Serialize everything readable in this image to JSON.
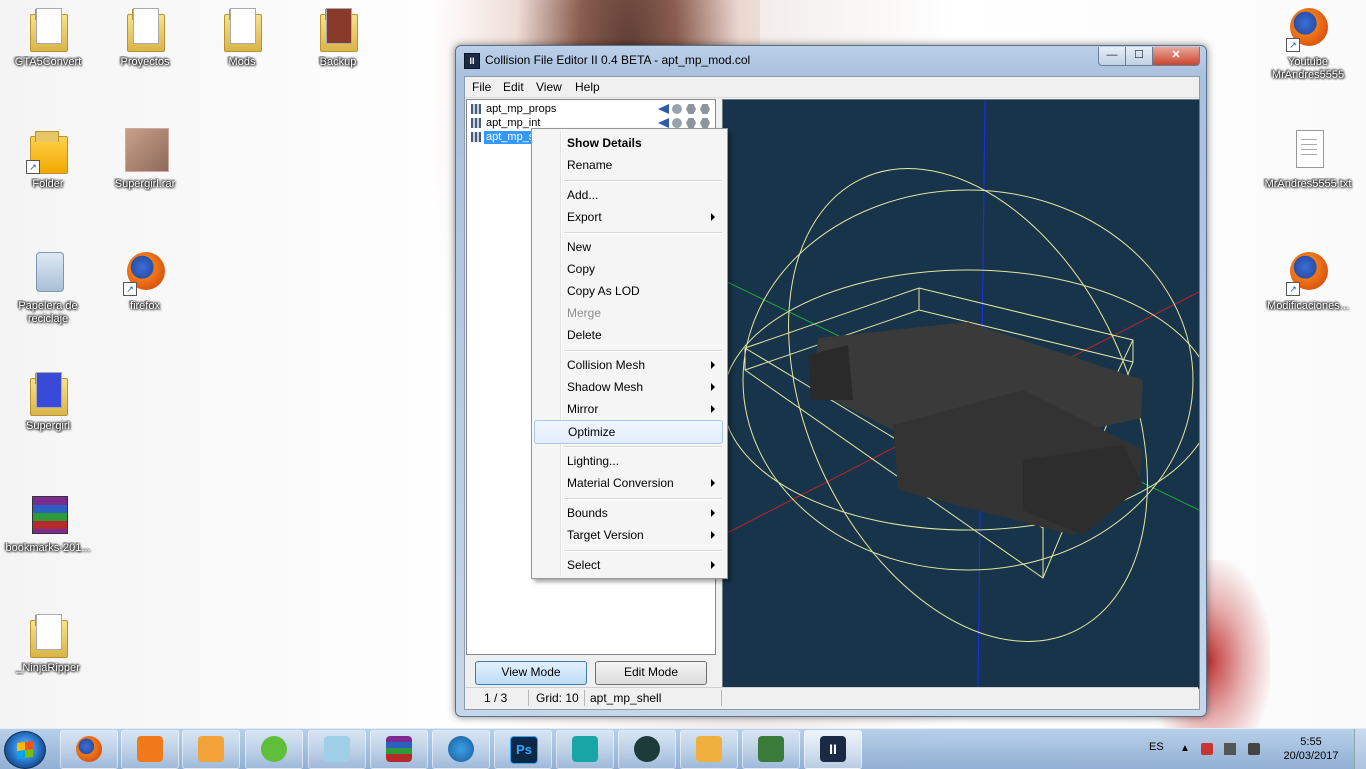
{
  "desktop": {
    "icons": [
      {
        "label": "GTA5Convert",
        "icon": "folder-icon"
      },
      {
        "label": "Proyectos",
        "icon": "folder-icon"
      },
      {
        "label": "Mods",
        "icon": "folder-icon"
      },
      {
        "label": "Backup",
        "icon": "folder-icon"
      },
      {
        "label": "Folder",
        "icon": "folder-shortcut-icon"
      },
      {
        "label": "Supergirl.rar",
        "icon": "archive-icon"
      },
      {
        "label": "Papelera de reciclaje",
        "icon": "recycle-bin-icon"
      },
      {
        "label": "firefox",
        "icon": "firefox-icon"
      },
      {
        "label": "Supergirl",
        "icon": "folder-icon"
      },
      {
        "label": "bookmarks-201...",
        "icon": "winrar-icon"
      },
      {
        "label": "_NinjaRipper",
        "icon": "folder-icon"
      },
      {
        "label": "Youtube MrAndres5555",
        "icon": "firefox-icon"
      },
      {
        "label": "MrAndres5555.txt",
        "icon": "text-file-icon"
      },
      {
        "label": "Modificaciones...",
        "icon": "firefox-icon"
      }
    ]
  },
  "window": {
    "title": "Collision File Editor II 0.4 BETA - apt_mp_mod.col",
    "controls": {
      "minimize": "—",
      "maximize": "☐",
      "close": "✕"
    }
  },
  "menubar": [
    "File",
    "Edit",
    "View",
    "Help"
  ],
  "tree": {
    "items": [
      {
        "label": "apt_mp_props",
        "selected": false
      },
      {
        "label": "apt_mp_int",
        "selected": false
      },
      {
        "label": "apt_mp_s",
        "selected": true
      }
    ]
  },
  "context_menu": {
    "items": [
      {
        "label": "Show Details",
        "bold": true
      },
      {
        "label": "Rename"
      },
      {
        "label": "Add..."
      },
      {
        "label": "Export",
        "submenu": true
      },
      {
        "label": "New"
      },
      {
        "label": "Copy"
      },
      {
        "label": "Copy As LOD"
      },
      {
        "label": "Merge",
        "disabled": true
      },
      {
        "label": "Delete"
      },
      {
        "label": "Collision Mesh",
        "submenu": true
      },
      {
        "label": "Shadow Mesh",
        "submenu": true
      },
      {
        "label": "Mirror",
        "submenu": true
      },
      {
        "label": "Optimize",
        "hover": true
      },
      {
        "label": "Lighting..."
      },
      {
        "label": "Material Conversion",
        "submenu": true
      },
      {
        "label": "Bounds",
        "submenu": true
      },
      {
        "label": "Target Version",
        "submenu": true
      },
      {
        "label": "Select",
        "submenu": true
      }
    ]
  },
  "buttons": {
    "view_mode": "View Mode",
    "edit_mode": "Edit Mode"
  },
  "statusbar": {
    "index": "1 / 3",
    "grid": "Grid: 10",
    "selection": "apt_mp_shell"
  },
  "taskbar": {
    "language": "ES",
    "time": "5:55",
    "date": "20/03/2017"
  },
  "colors": {
    "viewport_bg": "#17344a",
    "wireframe": "#e6e6a0",
    "axis_blue": "#1a2fd8",
    "axis_red": "#c02424",
    "axis_green": "#1fa83a",
    "mesh": "#3a3a3a"
  }
}
